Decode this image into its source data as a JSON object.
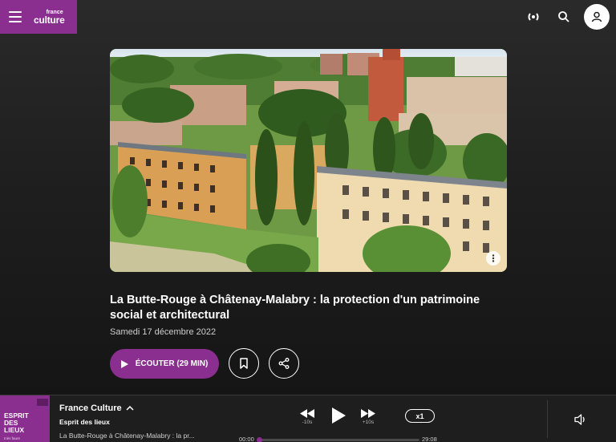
{
  "header": {
    "logo_top": "france",
    "logo_bottom": "culture"
  },
  "article": {
    "title": "La Butte-Rouge à Châtenay-Malabry : la protection d'un patrimoine social et architectural",
    "date": "Samedi 17 décembre 2022",
    "listen_label": "ÉCOUTER (29 MIN)"
  },
  "player": {
    "cover_title_1": "ESPRIT",
    "cover_title_2": "DES",
    "cover_title_3": "LIEUX",
    "cover_sub": "Inès faure",
    "station": "France Culture",
    "show": "Esprit des lieux",
    "episode": "La Butte-Rouge à Châtenay-Malabry : la pr...",
    "back_label": "-10s",
    "forward_label": "+10s",
    "speed": "x1",
    "current_time": "00:00",
    "duration": "29:08",
    "progress": 0.0
  },
  "colors": {
    "accent": "#8a2e8f",
    "background": "#1b1b1b"
  },
  "icons": {
    "menu": "hamburger-icon",
    "live": "live-radio-icon",
    "search": "search-icon",
    "account": "user-icon",
    "more": "more-vertical-icon",
    "play": "play-icon",
    "bookmark": "bookmark-icon",
    "share": "share-icon",
    "chevron": "chevron-up-icon",
    "rewind": "rewind-icon",
    "forward": "fast-forward-icon",
    "volume": "volume-icon"
  }
}
